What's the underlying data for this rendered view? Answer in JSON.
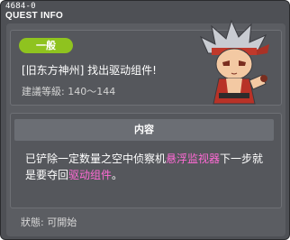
{
  "window": {
    "quest_id": "4684-0",
    "title": "QUEST INFO"
  },
  "quest": {
    "category": "一般",
    "title": "[旧东方神州] 找出驱动组件!",
    "level": "建議等級: 140～144"
  },
  "content": {
    "header": "内容",
    "desc_part1": "已铲除一定数量之空中侦察机",
    "desc_highlight1": "悬浮监视器",
    "desc_part2": "下一步就是要夺回",
    "desc_highlight2": "驱动组件",
    "desc_part3": "。"
  },
  "status": {
    "text": "狀態: 可開始"
  },
  "colors": {
    "badge": "#8fc31f",
    "highlight": "#ff6ad5",
    "window_bg": "#4e5055"
  }
}
